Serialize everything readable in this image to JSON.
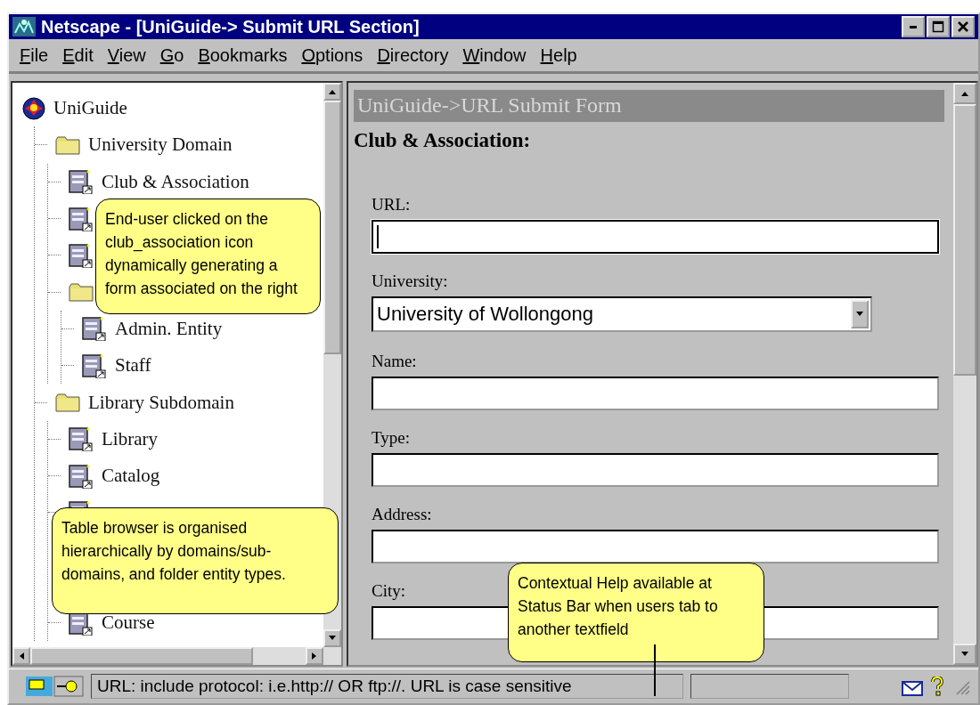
{
  "window": {
    "title": "Netscape - [UniGuide-> Submit URL Section]"
  },
  "menu": [
    {
      "label": "File"
    },
    {
      "label": "Edit"
    },
    {
      "label": "View"
    },
    {
      "label": "Go"
    },
    {
      "label": "Bookmarks"
    },
    {
      "label": "Options"
    },
    {
      "label": "Directory"
    },
    {
      "label": "Window"
    },
    {
      "label": "Help"
    }
  ],
  "tree": {
    "root": {
      "label": "UniGuide",
      "kind": "globe",
      "children": [
        {
          "label": "University Domain",
          "kind": "folder",
          "children": [
            {
              "label": "Club & Association",
              "kind": "document"
            },
            {
              "kind": "document"
            },
            {
              "kind": "document"
            },
            {
              "kind": "folder",
              "children": [
                {
                  "label": "Admin. Entity",
                  "kind": "document"
                },
                {
                  "label": "Staff",
                  "kind": "document"
                }
              ]
            }
          ]
        },
        {
          "label": "Library Subdomain",
          "kind": "folder",
          "children": [
            {
              "label": "Library",
              "kind": "document"
            },
            {
              "label": "Catalog",
              "kind": "document"
            },
            {
              "kind": "document"
            },
            {
              "label": "Course",
              "kind": "document"
            }
          ]
        }
      ]
    }
  },
  "form": {
    "banner": "UniGuide->URL Submit Form",
    "heading": "Club & Association:",
    "fields": [
      {
        "label": "URL:",
        "kind": "text",
        "focused": true
      },
      {
        "label": "University:",
        "kind": "select",
        "value": "University of Wollongong"
      },
      {
        "label": "Name:",
        "kind": "text",
        "focused": false
      },
      {
        "label": "Type:",
        "kind": "text",
        "focused": false
      },
      {
        "label": "Address:",
        "kind": "text",
        "focused": false
      },
      {
        "label": "City:",
        "kind": "text",
        "focused": false
      }
    ]
  },
  "status_bar": {
    "message": "URL: include protocol: i.e.http:// OR ftp://. URL is case sensitive"
  },
  "callouts": [
    {
      "text": "End-user clicked on the club_association icon dynamically generating a form associated on the right",
      "pointer": false
    },
    {
      "text": "Table browser is organised hierarchically by domains/sub-domains, and folder entity types.",
      "pointer": false
    },
    {
      "text": "Contextual Help available at Status Bar when users tab to another textfield",
      "pointer": true
    }
  ]
}
